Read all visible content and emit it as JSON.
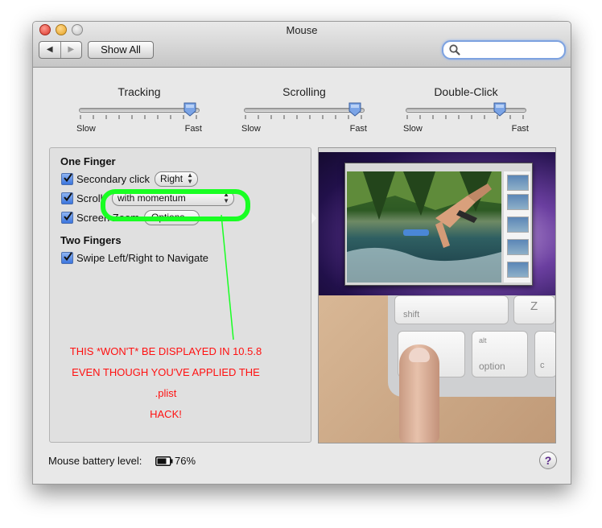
{
  "window": {
    "title": "Mouse",
    "show_all_label": "Show All",
    "back_glyph": "◀",
    "forward_glyph": "▶",
    "search_placeholder": ""
  },
  "sliders": [
    {
      "name": "Tracking",
      "min_label": "Slow",
      "max_label": "Fast",
      "value_fraction": 0.93
    },
    {
      "name": "Scrolling",
      "min_label": "Slow",
      "max_label": "Fast",
      "value_fraction": 0.93
    },
    {
      "name": "Double-Click",
      "min_label": "Slow",
      "max_label": "Fast",
      "value_fraction": 0.79
    }
  ],
  "gestures": {
    "one_finger_title": "One Finger",
    "secondary_click": {
      "label": "Secondary click",
      "checked": true,
      "popup_value": "Right"
    },
    "scroll": {
      "label": "Scroll",
      "checked": true,
      "popup_value": "with momentum"
    },
    "screen_zoom": {
      "label": "Screen Zoom",
      "checked": true,
      "button_label": "Options..."
    },
    "two_fingers_title": "Two Fingers",
    "swipe": {
      "label": "Swipe Left/Right to Navigate",
      "checked": true
    }
  },
  "annotation": {
    "line1": "THIS *WON'T* BE DISPLAYED IN 10.5.8",
    "line2": "EVEN THOUGH YOU'VE APPLIED THE .plist",
    "line3": "HACK!",
    "color": "#ff1010",
    "highlight_color": "#19ff23"
  },
  "preview": {
    "keys": {
      "shift": "shift",
      "z": "Z",
      "alt": "alt",
      "option": "option",
      "co": "co",
      "c": "c"
    }
  },
  "footer": {
    "battery_label": "Mouse battery level:",
    "battery_percent": "76%",
    "battery_level": 0.76,
    "help_glyph": "?"
  }
}
